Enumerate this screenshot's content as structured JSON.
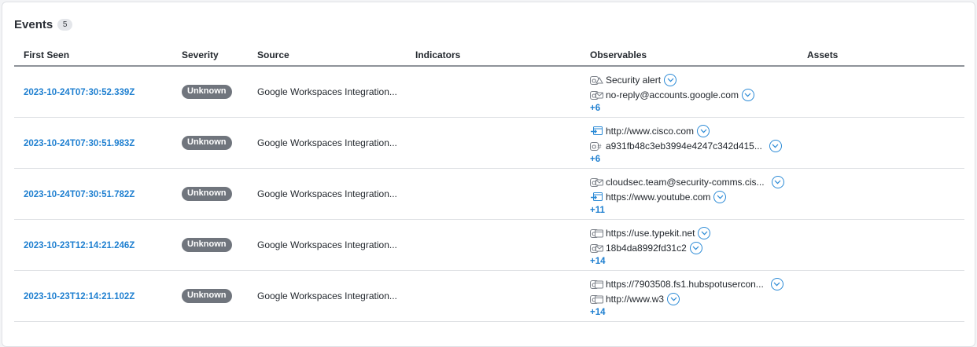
{
  "panel": {
    "title": "Events",
    "count": "5"
  },
  "columns": {
    "first_seen": "First Seen",
    "severity": "Severity",
    "source": "Source",
    "indicators": "Indicators",
    "observables": "Observables",
    "assets": "Assets"
  },
  "rows": [
    {
      "first_seen": "2023-10-24T07:30:52.339Z",
      "severity": "Unknown",
      "source": "Google Workspaces Integration...",
      "observables": [
        {
          "type_icon": "email-subject-icon",
          "value": "Security alert"
        },
        {
          "type_icon": "email-icon",
          "value": "no-reply@accounts.google.com"
        }
      ],
      "more": "+6"
    },
    {
      "first_seen": "2023-10-24T07:30:51.983Z",
      "severity": "Unknown",
      "source": "Google Workspaces Integration...",
      "observables": [
        {
          "type_icon": "url-icon",
          "value": "http://www.cisco.com"
        },
        {
          "type_icon": "hash-icon",
          "value": "a931fb48c3eb3994e4247c342d415..."
        }
      ],
      "more": "+6"
    },
    {
      "first_seen": "2023-10-24T07:30:51.782Z",
      "severity": "Unknown",
      "source": "Google Workspaces Integration...",
      "observables": [
        {
          "type_icon": "email-icon",
          "value": "cloudsec.team@security-comms.cis..."
        },
        {
          "type_icon": "url-icon",
          "value": "https://www.youtube.com"
        }
      ],
      "more": "+11"
    },
    {
      "first_seen": "2023-10-23T12:14:21.246Z",
      "severity": "Unknown",
      "source": "Google Workspaces Integration...",
      "observables": [
        {
          "type_icon": "domain-icon",
          "value": "https://use.typekit.net"
        },
        {
          "type_icon": "email-icon",
          "value": "18b4da8992fd31c2"
        }
      ],
      "more": "+14"
    },
    {
      "first_seen": "2023-10-23T12:14:21.102Z",
      "severity": "Unknown",
      "source": "Google Workspaces Integration...",
      "observables": [
        {
          "type_icon": "domain-icon",
          "value": "https://7903508.fs1.hubspotusercon..."
        },
        {
          "type_icon": "domain-icon",
          "value": "http://www.w3"
        }
      ],
      "more": "+14"
    }
  ],
  "colors": {
    "link": "#1e7fd0",
    "severity_unknown": "#70757d",
    "chevron": "#2b8ad6"
  }
}
